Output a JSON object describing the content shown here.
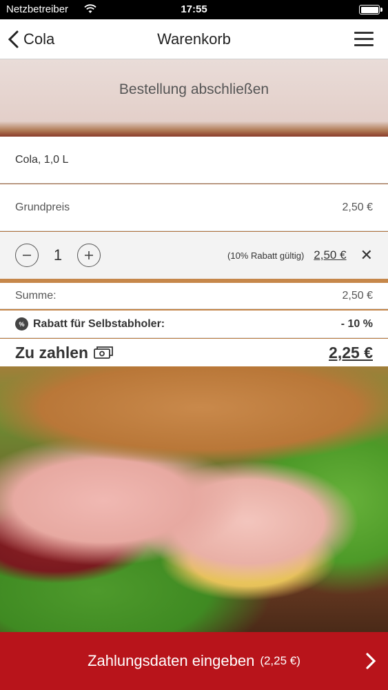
{
  "status_bar": {
    "carrier": "Netzbetreiber",
    "time": "17:55",
    "wifi_icon": "wifi-icon",
    "battery_icon": "battery-icon"
  },
  "nav": {
    "back_label": "Cola",
    "title": "Warenkorb",
    "menu_icon": "hamburger-menu-icon"
  },
  "header": {
    "title": "Bestellung abschließen"
  },
  "cart": {
    "product_name": "Cola, 1,0 L",
    "base_price_label": "Grundpreis",
    "base_price_value": "2,50 €",
    "quantity": "1",
    "discount_note": "(10% Rabatt gültig)",
    "line_price": "2,50 €",
    "remove_symbol": "✕"
  },
  "summary": {
    "sum_label": "Summe:",
    "sum_value": "2,50 €",
    "discount_badge": "%",
    "discount_label": "Rabatt für Selbstabholer:",
    "discount_value": "- 10 %",
    "total_label": "Zu zahlen",
    "total_value": "2,25 €"
  },
  "pay_button": {
    "label": "Zahlungsdaten eingeben",
    "amount": "(2,25 €)"
  },
  "colors": {
    "accent": "#b8141b",
    "text": "#333333"
  }
}
